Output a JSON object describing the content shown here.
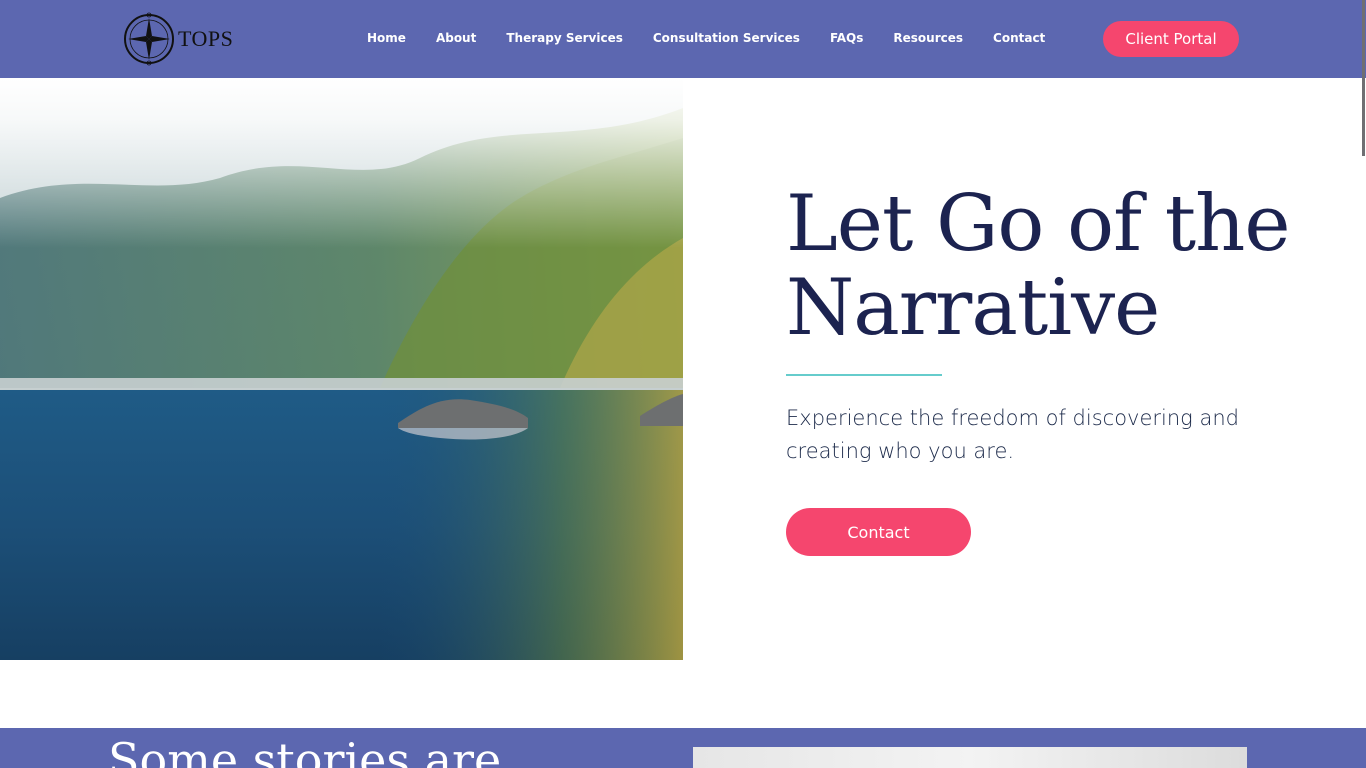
{
  "header": {
    "logo_text": "TOPS",
    "logo_icon": "compass-icon",
    "nav": [
      "Home",
      "About",
      "Therapy Services",
      "Consultation Services",
      "FAQs",
      "Resources",
      "Contact"
    ],
    "portal_label": "Client Portal"
  },
  "hero": {
    "image": "lake-forest-reflection-image",
    "title_line1": "Let Go of the",
    "title_line2": "Narrative",
    "subtitle": "Experience the freedom of discovering and creating who you are.",
    "cta_label": "Contact"
  },
  "next_section": {
    "heading": "Some stories are"
  },
  "colors": {
    "header_bg": "#5c67b0",
    "accent": "#f5466e",
    "title": "#1c2350",
    "rule": "#66cccc"
  }
}
